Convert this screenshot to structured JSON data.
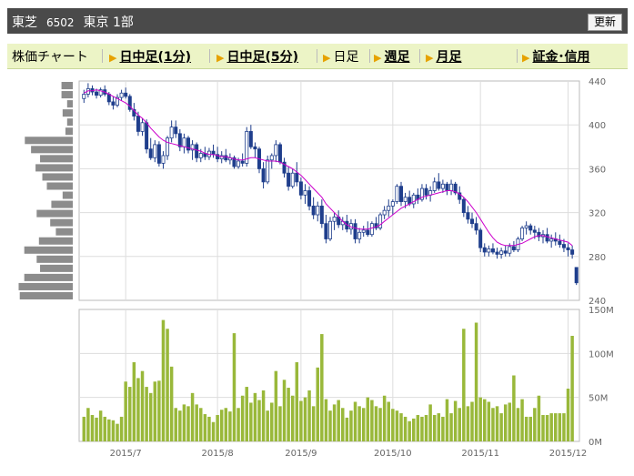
{
  "header": {
    "company": "東芝",
    "code": "6502",
    "market": "東京 1部",
    "refresh_label": "更新"
  },
  "nav": {
    "chart_label": "株価チャート",
    "items": [
      {
        "label": "日中足(1分)",
        "link": true
      },
      {
        "label": "日中足(5分)",
        "link": true
      },
      {
        "label": "日足",
        "link": false
      },
      {
        "label": "週足",
        "link": true
      },
      {
        "label": "月足",
        "link": true
      },
      {
        "label": "証金･信用",
        "link": true
      }
    ]
  },
  "colors": {
    "candle_up": "#ffffff",
    "candle_down": "#1f3e8c",
    "moving_average": "#cc00cc",
    "volume_bar": "#99b83a",
    "volume_profile": "#8c8c8c",
    "grid": "#dddddd"
  },
  "chart_data": [
    {
      "type": "candlestick",
      "y_ticks": [
        "440",
        "400",
        "360",
        "320",
        "280",
        "240"
      ],
      "ylim": [
        240,
        440
      ],
      "x_ticks": [
        "2015/7",
        "2015/8",
        "2015/9",
        "2015/10",
        "2015/11",
        "2015/12"
      ],
      "x_tick_index": [
        10,
        32,
        52,
        74,
        95,
        116
      ],
      "series": [
        {
          "values": [
            [
              424,
              432,
              420,
              428
            ],
            [
              428,
              438,
              425,
              433
            ],
            [
              433,
              436,
              427,
              430
            ],
            [
              430,
              433,
              424,
              427
            ],
            [
              427,
              434,
              425,
              432
            ],
            [
              432,
              436,
              426,
              428
            ],
            [
              428,
              430,
              418,
              421
            ],
            [
              421,
              426,
              414,
              418
            ],
            [
              418,
              428,
              416,
              425
            ],
            [
              425,
              432,
              422,
              429
            ],
            [
              429,
              434,
              424,
              426
            ],
            [
              426,
              428,
              412,
              414
            ],
            [
              414,
              420,
              404,
              408
            ],
            [
              408,
              412,
              390,
              394
            ],
            [
              394,
              406,
              390,
              402
            ],
            [
              402,
              405,
              374,
              378
            ],
            [
              378,
              388,
              368,
              370
            ],
            [
              370,
              386,
              366,
              382
            ],
            [
              382,
              385,
              362,
              365
            ],
            [
              365,
              376,
              360,
              372
            ],
            [
              372,
              390,
              368,
              388
            ],
            [
              388,
              404,
              384,
              398
            ],
            [
              398,
              404,
              388,
              392
            ],
            [
              392,
              396,
              376,
              380
            ],
            [
              380,
              392,
              374,
              388
            ],
            [
              388,
              390,
              374,
              377
            ],
            [
              377,
              386,
              368,
              382
            ],
            [
              382,
              384,
              366,
              370
            ],
            [
              370,
              378,
              366,
              374
            ],
            [
              374,
              380,
              368,
              371
            ],
            [
              371,
              379,
              368,
              376
            ],
            [
              376,
              382,
              370,
              373
            ],
            [
              373,
              380,
              366,
              369
            ],
            [
              369,
              376,
              365,
              372
            ],
            [
              372,
              378,
              366,
              368
            ],
            [
              368,
              374,
              364,
              370
            ],
            [
              370,
              372,
              360,
              362
            ],
            [
              362,
              370,
              360,
              367
            ],
            [
              367,
              374,
              362,
              365
            ],
            [
              365,
              398,
              362,
              394
            ],
            [
              394,
              400,
              378,
              380
            ],
            [
              380,
              384,
              370,
              378
            ],
            [
              378,
              380,
              356,
              360
            ],
            [
              360,
              366,
              342,
              348
            ],
            [
              348,
              372,
              346,
              368
            ],
            [
              368,
              374,
              360,
              372
            ],
            [
              372,
              386,
              366,
              382
            ],
            [
              382,
              384,
              364,
              366
            ],
            [
              366,
              370,
              352,
              356
            ],
            [
              356,
              362,
              340,
              344
            ],
            [
              344,
              360,
              342,
              356
            ],
            [
              356,
              366,
              344,
              348
            ],
            [
              348,
              352,
              332,
              336
            ],
            [
              336,
              346,
              328,
              340
            ],
            [
              340,
              344,
              322,
              326
            ],
            [
              326,
              334,
              314,
              318
            ],
            [
              318,
              330,
              312,
              326
            ],
            [
              326,
              332,
              306,
              310
            ],
            [
              310,
              318,
              292,
              296
            ],
            [
              296,
              316,
              294,
              312
            ],
            [
              312,
              320,
              304,
              316
            ],
            [
              316,
              322,
              306,
              309
            ],
            [
              309,
              316,
              304,
              312
            ],
            [
              312,
              318,
              302,
              305
            ],
            [
              305,
              314,
              300,
              310
            ],
            [
              310,
              314,
              292,
              296
            ],
            [
              296,
              306,
              292,
              302
            ],
            [
              302,
              308,
              298,
              304
            ],
            [
              304,
              312,
              298,
              300
            ],
            [
              300,
              312,
              298,
              310
            ],
            [
              310,
              316,
              304,
              306
            ],
            [
              306,
              320,
              304,
              318
            ],
            [
              318,
              326,
              314,
              322
            ],
            [
              322,
              332,
              316,
              326
            ],
            [
              326,
              332,
              318,
              330
            ],
            [
              330,
              346,
              328,
              344
            ],
            [
              344,
              348,
              326,
              330
            ],
            [
              330,
              338,
              324,
              334
            ],
            [
              334,
              340,
              326,
              328
            ],
            [
              328,
              338,
              324,
              336
            ],
            [
              336,
              342,
              328,
              332
            ],
            [
              332,
              346,
              330,
              342
            ],
            [
              342,
              346,
              332,
              336
            ],
            [
              336,
              344,
              330,
              340
            ],
            [
              340,
              352,
              338,
              348
            ],
            [
              348,
              356,
              340,
              342
            ],
            [
              342,
              350,
              338,
              346
            ],
            [
              346,
              348,
              336,
              340
            ],
            [
              340,
              350,
              336,
              346
            ],
            [
              346,
              348,
              336,
              338
            ],
            [
              338,
              344,
              328,
              332
            ],
            [
              332,
              334,
              316,
              320
            ],
            [
              320,
              326,
              310,
              314
            ],
            [
              314,
              320,
              306,
              310
            ],
            [
              310,
              316,
              300,
              304
            ],
            [
              304,
              306,
              284,
              288
            ],
            [
              288,
              292,
              280,
              284
            ],
            [
              284,
              290,
              280,
              287
            ],
            [
              287,
              292,
              282,
              284
            ],
            [
              284,
              288,
              278,
              282
            ],
            [
              282,
              288,
              278,
              285
            ],
            [
              285,
              290,
              280,
              283
            ],
            [
              283,
              292,
              280,
              289
            ],
            [
              289,
              294,
              284,
              286
            ],
            [
              286,
              298,
              284,
              296
            ],
            [
              296,
              308,
              294,
              306
            ],
            [
              306,
              312,
              300,
              308
            ],
            [
              308,
              310,
              300,
              304
            ],
            [
              304,
              308,
              296,
              302
            ],
            [
              302,
              306,
              294,
              298
            ],
            [
              298,
              304,
              292,
              300
            ],
            [
              300,
              306,
              292,
              294
            ],
            [
              294,
              300,
              288,
              296
            ],
            [
              296,
              302,
              290,
              294
            ],
            [
              294,
              300,
              288,
              291
            ],
            [
              291,
              296,
              284,
              288
            ],
            [
              288,
              292,
              280,
              286
            ],
            [
              286,
              290,
              278,
              282
            ],
            [
              270,
              268,
              254,
              256
            ]
          ]
        },
        {
          "name": "",
          "values": [
            429,
            431,
            431,
            432,
            431,
            430,
            428,
            426,
            424,
            422,
            420,
            417,
            413,
            409,
            406,
            402,
            397,
            393,
            389,
            386,
            384,
            383,
            382,
            381,
            380,
            379,
            378,
            377,
            376,
            374,
            373,
            373,
            372,
            371,
            371,
            370,
            369,
            368,
            368,
            369,
            370,
            370,
            369,
            368,
            367,
            367,
            367,
            366,
            364,
            362,
            360,
            357,
            354,
            350,
            346,
            342,
            338,
            334,
            328,
            324,
            320,
            316,
            312,
            309,
            307,
            306,
            305,
            305,
            305,
            306,
            307,
            309,
            312,
            315,
            318,
            321,
            324,
            326,
            328,
            330,
            332,
            334,
            335,
            336,
            337,
            338,
            339,
            340,
            340,
            339,
            337,
            334,
            330,
            325,
            320,
            314,
            308,
            302,
            297,
            293,
            291,
            290,
            290,
            290,
            291,
            292,
            294,
            296,
            298,
            299,
            299,
            298,
            297,
            296,
            295,
            294,
            293,
            290
          ]
        }
      ]
    },
    {
      "type": "bar",
      "y_ticks": [
        "150M",
        "100M",
        "50M",
        "0M"
      ],
      "ylim": [
        0,
        150
      ],
      "values": [
        28,
        38,
        30,
        27,
        35,
        28,
        25,
        24,
        20,
        28,
        68,
        62,
        90,
        72,
        80,
        62,
        55,
        68,
        69,
        138,
        128,
        85,
        38,
        35,
        42,
        40,
        55,
        42,
        38,
        31,
        28,
        22,
        30,
        36,
        38,
        34,
        123,
        38,
        52,
        62,
        44,
        55,
        47,
        58,
        35,
        44,
        80,
        40,
        70,
        61,
        52,
        90,
        46,
        50,
        58,
        40,
        84,
        122,
        48,
        35,
        42,
        47,
        38,
        27,
        35,
        45,
        40,
        38,
        50,
        47,
        40,
        38,
        52,
        45,
        37,
        35,
        32,
        28,
        23,
        26,
        30,
        28,
        30,
        42,
        30,
        32,
        28,
        48,
        32,
        46,
        38,
        128,
        40,
        45,
        135,
        50,
        48,
        45,
        38,
        40,
        32,
        42,
        44,
        75,
        38,
        48,
        28,
        28,
        38,
        52,
        30,
        30,
        32,
        32,
        32,
        32,
        60,
        120
      ]
    },
    {
      "type": "bar",
      "orientation": "horizontal",
      "values": [
        20,
        20,
        10,
        18,
        10,
        13,
        85,
        74,
        58,
        66,
        54,
        46,
        18,
        38,
        64,
        40,
        30,
        60,
        86,
        64,
        58,
        86,
        96,
        94
      ]
    }
  ]
}
